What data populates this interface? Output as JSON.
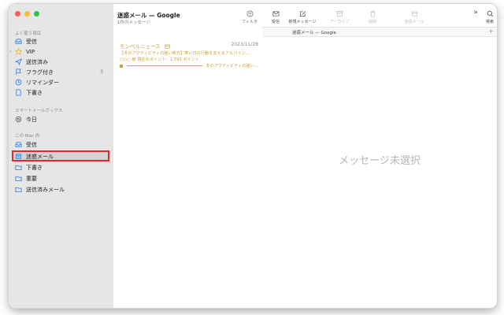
{
  "sidebar": {
    "favorites_header": "よく使う項目",
    "favorites": [
      {
        "label": "受信",
        "icon": "inbox-icon"
      },
      {
        "label": "VIP",
        "icon": "star-icon"
      },
      {
        "label": "送信済み",
        "icon": "paperplane-icon"
      },
      {
        "label": "フラグ付き",
        "icon": "flag-icon",
        "count": "3"
      },
      {
        "label": "リマインダー",
        "icon": "clock-icon"
      },
      {
        "label": "下書き",
        "icon": "doc-icon"
      }
    ],
    "smart_header": "スマートメールボックス",
    "smart": [
      {
        "label": "今日",
        "icon": "gear-icon"
      }
    ],
    "mac_header": "この Mac 内",
    "mac": [
      {
        "label": "受信",
        "icon": "inbox-icon"
      },
      {
        "label": "迷惑メール",
        "icon": "junk-icon"
      },
      {
        "label": "下書き",
        "icon": "folder-icon"
      },
      {
        "label": "重要",
        "icon": "folder-icon"
      },
      {
        "label": "送信済みメール",
        "icon": "folder-icon"
      }
    ]
  },
  "list": {
    "title": "迷惑メール — Google",
    "subtitle": "1件のメッセージ",
    "filter_label": "フィルタ",
    "message": {
      "sender": "モンベルニュース",
      "date": "2023/11/28",
      "line1": "【冬のアクティビティの強い味方】寒い日の行動を支えるアルパイン…",
      "line2": "○○○ 様 現在のポイント：1,793 ポイント",
      "line3": "冬のアクティビティの強い…"
    }
  },
  "toolbar": {
    "receive": "受信",
    "compose": "新規メッセージ",
    "archive": "アーカイブ",
    "delete": "削除",
    "junk": "迷惑メール",
    "search": "検索"
  },
  "reading": {
    "tab_label": "迷惑メール — Google",
    "empty_message": "メッセージ未選択"
  },
  "colors": {
    "accent": "#2a7ae2",
    "highlight": "#e8262f",
    "newsletter": "#c8a13a"
  }
}
